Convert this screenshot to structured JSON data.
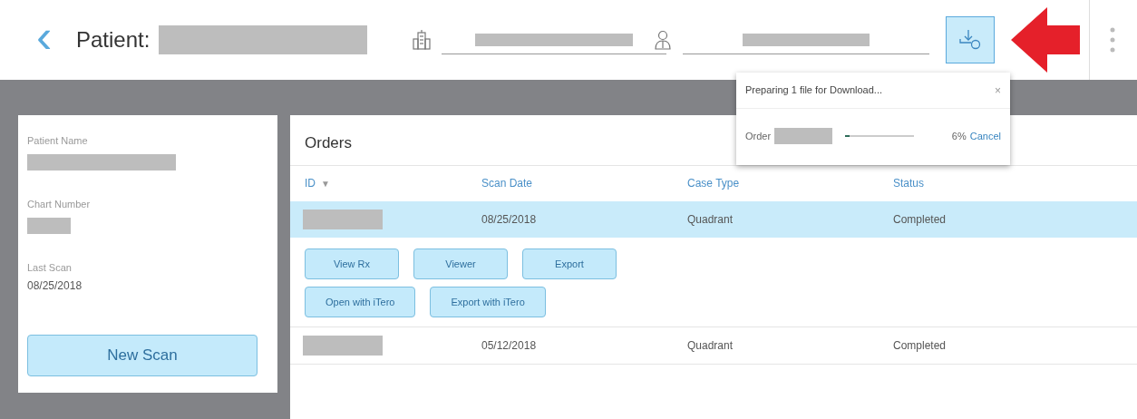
{
  "header": {
    "back": "‹",
    "patient_label": "Patient:"
  },
  "download_popup": {
    "title": "Preparing 1 file for Download...",
    "close": "×",
    "order_label": "Order",
    "level": 0.06,
    "percent": "6%",
    "cancel": "Cancel"
  },
  "patient_card": {
    "fields": [
      {
        "label": "Patient Name",
        "value_hidden": true
      },
      {
        "label": "Chart Number",
        "value_hidden": true
      },
      {
        "label": "Last Scan",
        "value": "08/25/2018"
      }
    ],
    "new_scan": "New Scan"
  },
  "orders": {
    "title": "Orders",
    "columns": [
      {
        "label": "ID",
        "sort": "▼"
      },
      {
        "label": "Scan Date"
      },
      {
        "label": "Case Type"
      },
      {
        "label": "Status"
      }
    ],
    "rows": [
      {
        "selected": true,
        "scan_date": "08/25/2018",
        "case_type": "Quadrant",
        "status": "Completed",
        "actions": [
          [
            "View Rx",
            "Viewer",
            "Export"
          ],
          [
            "Open with iTero",
            "Export with iTero"
          ]
        ]
      },
      {
        "selected": false,
        "scan_date": "05/12/2018",
        "case_type": "Quadrant",
        "status": "Completed"
      }
    ]
  }
}
